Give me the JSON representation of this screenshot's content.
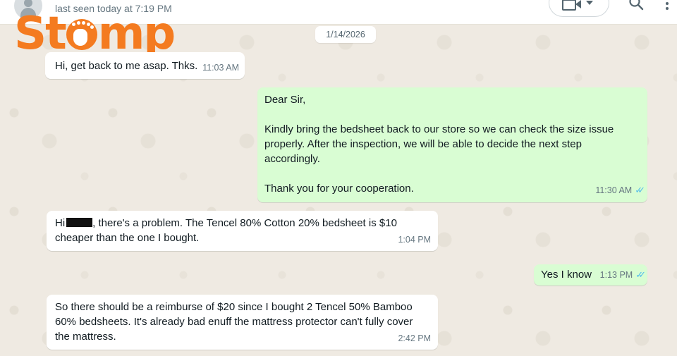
{
  "header": {
    "last_seen": "last seen today at 7:19 PM"
  },
  "watermark": {
    "text": "Stomp",
    "color": "#f47b20"
  },
  "date_divider": "1/14/2026",
  "messages": [
    {
      "direction": "incoming",
      "text": "Hi, get back to me asap. Thks.",
      "time": "11:03 AM"
    },
    {
      "direction": "outgoing",
      "text": "Dear Sir,\n\nKindly bring the bedsheet back to our store so we can check the size issue properly. After the inspection, we will be able to decide the next step accordingly.\n\nThank you for your cooperation.",
      "time": "11:30 AM",
      "ticks": "✓✓"
    },
    {
      "direction": "incoming",
      "text_before_redaction": "Hi",
      "text_after_redaction": ", there's a problem. The Tencel 80%  Cotton 20% bedsheet is $10 cheaper than the one I bought.",
      "time": "1:04 PM"
    },
    {
      "direction": "outgoing",
      "text": "Yes I know",
      "time": "1:13 PM",
      "ticks": "✓✓"
    },
    {
      "direction": "incoming",
      "text": "So there should be a reimburse of $20 since I bought 2 Tencel 50% Bamboo 60% bedsheets. It's already bad enuff the mattress protector can't fully cover the mattress.",
      "time": "2:42 PM"
    }
  ],
  "colors": {
    "chat_background": "#efeae2",
    "incoming_bubble": "#ffffff",
    "outgoing_bubble": "#d9fdd3",
    "read_ticks": "#53bdeb"
  },
  "icons": [
    "avatar-icon",
    "video-call-icon",
    "chevron-down-icon",
    "search-icon",
    "menu-dots-icon",
    "double-check-icon"
  ]
}
